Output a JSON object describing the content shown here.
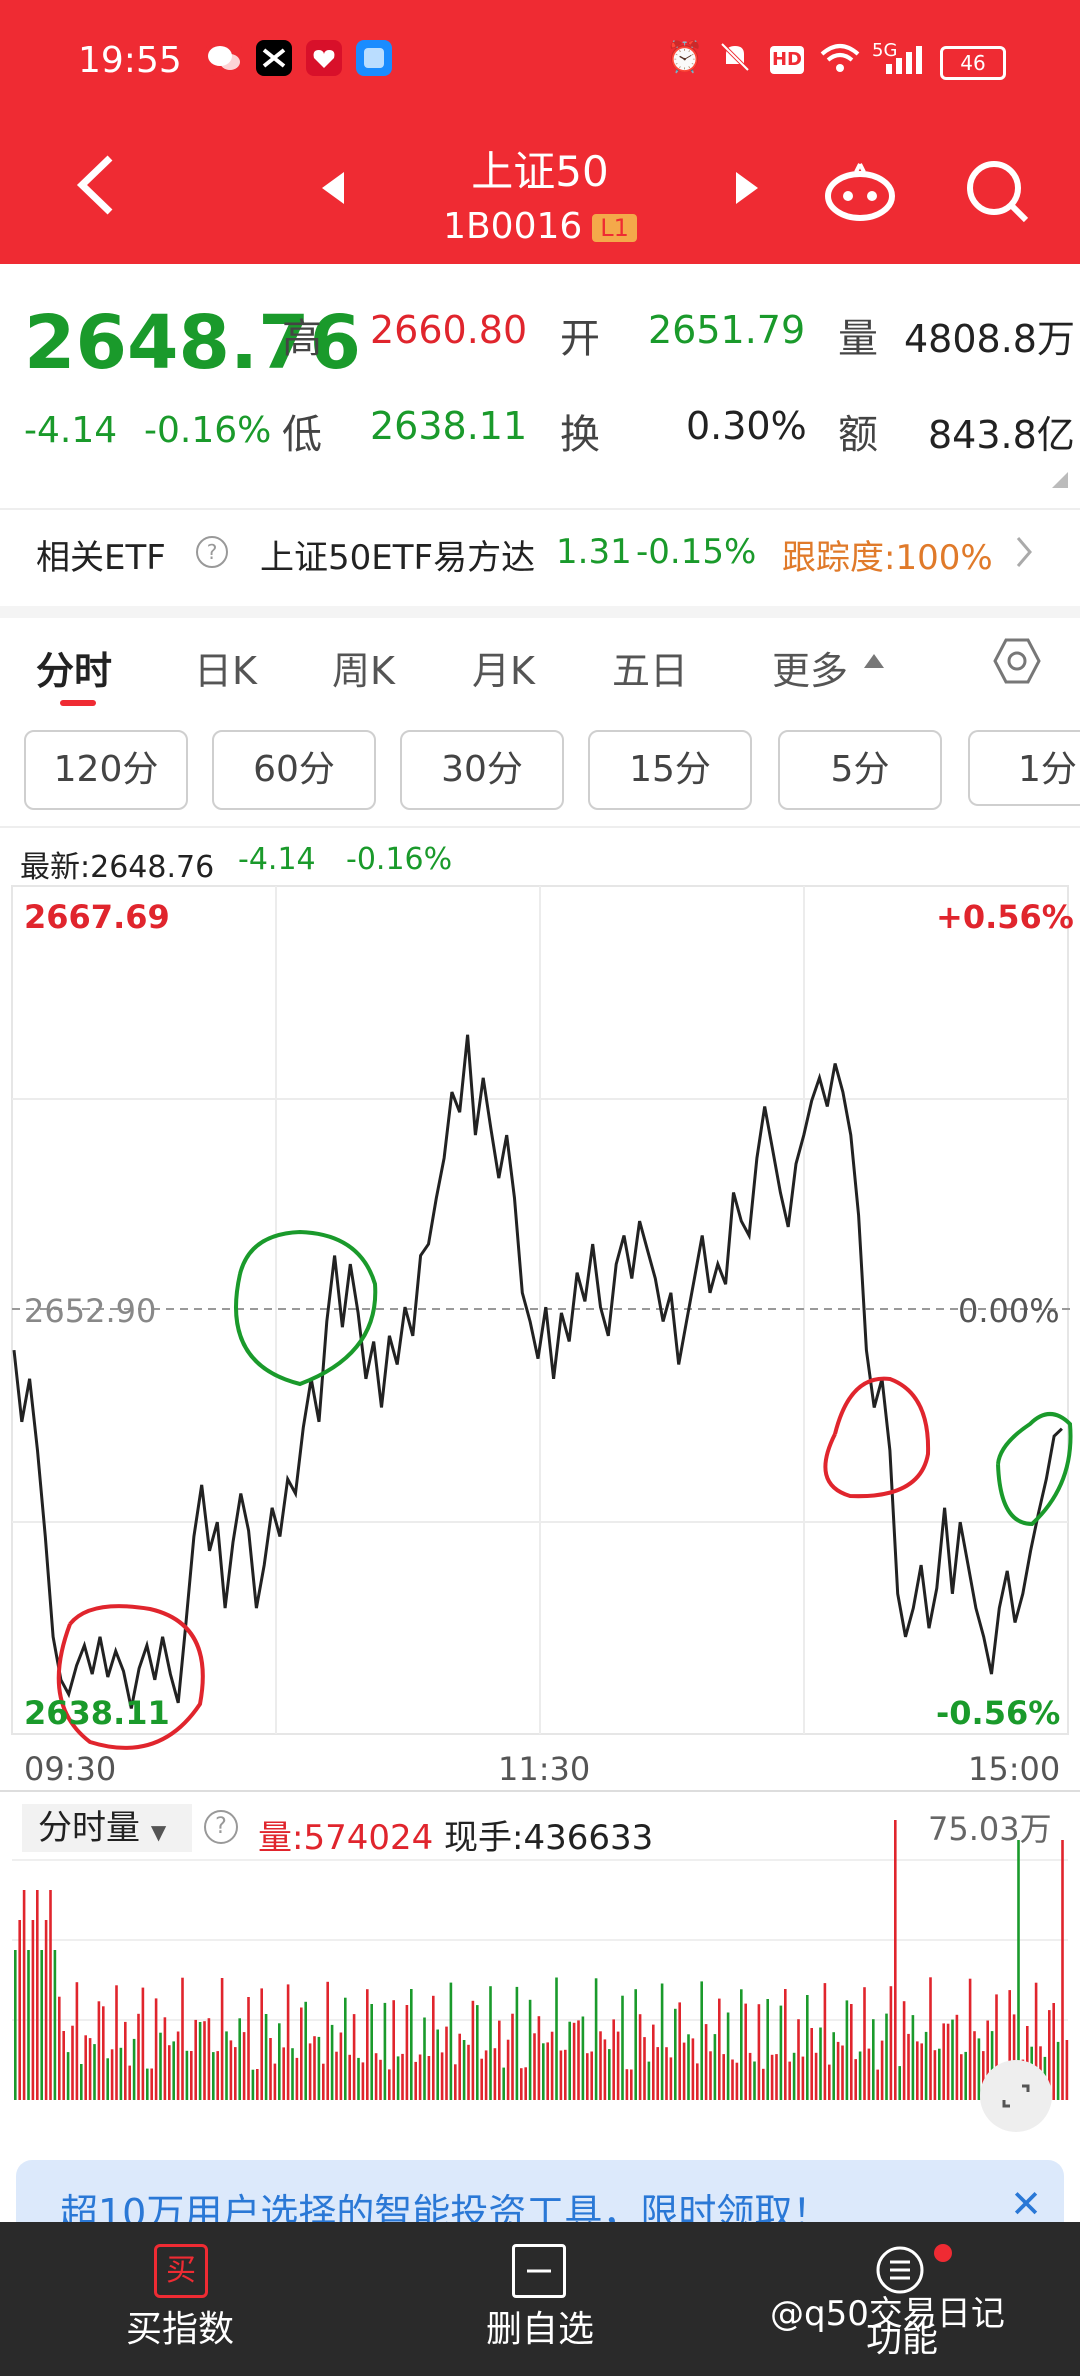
{
  "status_bar": {
    "time": "19:55",
    "battery": "46",
    "net": "5G"
  },
  "header": {
    "title": "上证50",
    "code": "1B0016",
    "level_badge": "L1"
  },
  "quote": {
    "price": "2648.76",
    "change": "-4.14",
    "change_pct": "-0.16%",
    "high_label": "高",
    "high": "2660.80",
    "open_label": "开",
    "open": "2651.79",
    "volume_label": "量",
    "volume": "4808.8万",
    "low_label": "低",
    "low": "2638.11",
    "turnover_label": "换",
    "turnover": "0.30%",
    "amount_label": "额",
    "amount": "843.8亿"
  },
  "etf": {
    "label": "相关ETF",
    "name": "上证50ETF易方达",
    "price": "1.31",
    "change_pct": "-0.15%",
    "tracking": "跟踪度:100%"
  },
  "tabs": [
    "分时",
    "日K",
    "周K",
    "月K",
    "五日",
    "更多"
  ],
  "intervals": [
    "120分",
    "60分",
    "30分",
    "15分",
    "5分",
    "1分"
  ],
  "latest": {
    "label": "最新:2648.76",
    "change": "-4.14",
    "pct": "-0.16%"
  },
  "chart_data": {
    "type": "line",
    "title": "",
    "y_max": "2667.69",
    "y_mid": "2652.90",
    "y_min": "2638.11",
    "pct_max": "+0.56%",
    "pct_mid": "0.00%",
    "pct_min": "-0.56%",
    "x_labels": [
      "09:30",
      "11:30",
      "15:00"
    ],
    "ylim": [
      2638.11,
      2667.69
    ],
    "series": [
      {
        "values": [
          2651.5,
          2649.0,
          2650.5,
          2648.0,
          2645.0,
          2641.5,
          2640.0,
          2639.5,
          2640.5,
          2641.2,
          2640.2,
          2641.5,
          2640.1,
          2641.0,
          2640.3,
          2639.0,
          2640.4,
          2641.2,
          2640.0,
          2641.5,
          2640.2,
          2639.2,
          2642.0,
          2645.0,
          2646.8,
          2644.5,
          2645.5,
          2642.5,
          2644.8,
          2646.5,
          2645.2,
          2642.5,
          2644.0,
          2646.0,
          2645.0,
          2647.0,
          2646.5,
          2648.8,
          2650.5,
          2649.0,
          2652.5,
          2654.8,
          2652.3,
          2654.5,
          2652.8,
          2650.5,
          2651.8,
          2649.5,
          2652.0,
          2651.0,
          2653.0,
          2652.0,
          2654.8,
          2655.2,
          2656.8,
          2658.2,
          2660.5,
          2659.8,
          2662.5,
          2659.0,
          2661.0,
          2659.2,
          2657.5,
          2659.0,
          2656.8,
          2653.5,
          2652.5,
          2651.2,
          2653.0,
          2650.5,
          2652.8,
          2651.8,
          2654.2,
          2653.2,
          2655.2,
          2653.0,
          2652.0,
          2654.5,
          2655.5,
          2654.0,
          2656.0,
          2655.0,
          2654.0,
          2652.5,
          2653.5,
          2651.0,
          2652.5,
          2654.0,
          2655.5,
          2653.5,
          2654.5,
          2653.8,
          2657.0,
          2656.0,
          2655.5,
          2658.2,
          2660.0,
          2658.5,
          2657.0,
          2655.8,
          2658.0,
          2659.0,
          2660.2,
          2661.0,
          2660.0,
          2661.5,
          2660.5,
          2659.0,
          2656.2,
          2651.5,
          2649.5,
          2650.5,
          2648.0,
          2643.0,
          2641.5,
          2642.5,
          2644.0,
          2641.8,
          2643.2,
          2646.0,
          2643.0,
          2645.5,
          2644.0,
          2642.5,
          2641.5,
          2640.2,
          2642.5,
          2643.8,
          2642.0,
          2643.0,
          2644.5,
          2645.8,
          2647.0,
          2648.5,
          2648.76
        ]
      }
    ]
  },
  "volume_panel": {
    "indicator": "分时量",
    "vol_label": "量:574024",
    "cur_label": "现手:436633",
    "max": "75.03万"
  },
  "banner": {
    "text": "超10万用户选择的智能投资工具，限时领取！"
  },
  "nav": {
    "buy": "买指数",
    "remove": "删自选",
    "func": "功能",
    "watermark": "@q50交易日记"
  }
}
